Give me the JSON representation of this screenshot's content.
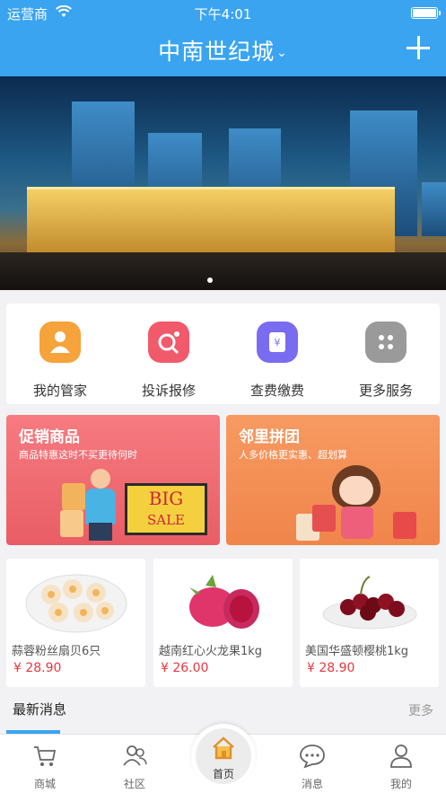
{
  "status_bar": {
    "carrier": "运营商",
    "time": "下午4:01"
  },
  "nav": {
    "title": "中南世纪城",
    "dropdown_glyph": "⌄"
  },
  "services": [
    {
      "label": "我的管家",
      "icon": "butler-icon",
      "color": "#f5a33a"
    },
    {
      "label": "投诉报修",
      "icon": "repair-icon",
      "color": "#f05a6a"
    },
    {
      "label": "查费缴费",
      "icon": "payment-icon",
      "color": "#7a6cf0"
    },
    {
      "label": "更多服务",
      "icon": "more-services-icon",
      "color": "#9a9a9a"
    }
  ],
  "promos": [
    {
      "title": "促销商品",
      "subtitle": "商品特惠这时不买更待何时",
      "badge_big": "BIG",
      "badge_sale": "SALE"
    },
    {
      "title": "邻里拼团",
      "subtitle": "人多价格更实惠、超划算"
    }
  ],
  "products": [
    {
      "name": "蒜蓉粉丝扇贝6只",
      "price": "¥ 28.90"
    },
    {
      "name": "越南红心火龙果1kg",
      "price": "¥ 26.00"
    },
    {
      "name": "美国华盛顿樱桃1kg",
      "price": "¥ 28.90"
    }
  ],
  "news": {
    "title": "最新消息",
    "more": "更多"
  },
  "tabs": {
    "mall": "商城",
    "community": "社区",
    "home": "首页",
    "messages": "消息",
    "mine": "我的"
  }
}
